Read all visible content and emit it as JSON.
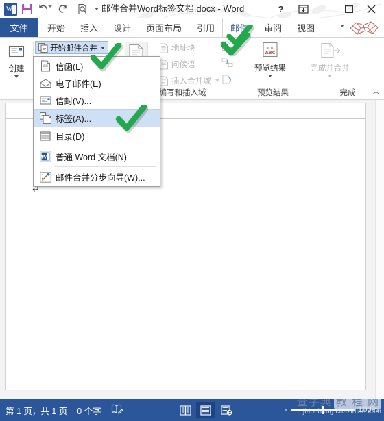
{
  "titlebar": {
    "document_title": "邮件合并Word标签文档.docx - Word",
    "quick_access": [
      {
        "name": "word-logo",
        "label": "W"
      },
      {
        "name": "save-icon",
        "label": "保存"
      },
      {
        "name": "undo-icon",
        "label": "撤消"
      },
      {
        "name": "redo-icon",
        "label": "恢复"
      },
      {
        "name": "print-preview-icon",
        "label": "打印预览和打印"
      }
    ],
    "help_label": "?",
    "ribbon_display_label": "⛶",
    "minimize_label": "—",
    "maximize_label": "❐",
    "close_label": "✕"
  },
  "tabs": {
    "file_label": "文件",
    "items": [
      {
        "label": "开始",
        "active": false
      },
      {
        "label": "插入",
        "active": false
      },
      {
        "label": "设计",
        "active": false
      },
      {
        "label": "页面布局",
        "active": false
      },
      {
        "label": "引用",
        "active": false
      },
      {
        "label": "邮件",
        "active": true
      },
      {
        "label": "审阅",
        "active": false
      },
      {
        "label": "视图",
        "active": false
      }
    ]
  },
  "ribbon": {
    "groups": [
      {
        "name": "create",
        "label": "创建"
      },
      {
        "name": "start-mail-merge",
        "label": "开始邮件合并"
      },
      {
        "name": "write-insert-fields",
        "label": "编写和插入域"
      },
      {
        "name": "preview-results",
        "label": "预览结果"
      },
      {
        "name": "finish",
        "label": "完成"
      }
    ],
    "create_button": "创建",
    "start_mailmerge_button": "开始邮件合并",
    "address_block": "地址块",
    "greeting_line": "问候语",
    "insert_merge_field": "插入合并域",
    "write_insert_group_label": "编写和插入域",
    "preview_results_button": "预览结果",
    "preview_group_label": "预览结果",
    "finish_merge_button": "完成并合并",
    "finish_group_label": "完成",
    "collapse_ribbon": "︿"
  },
  "menu": {
    "items": [
      {
        "label": "信函(L)",
        "icon": "letter-icon",
        "selected": false,
        "sep_after": false
      },
      {
        "label": "电子邮件(E)",
        "icon": "envelope-open-icon",
        "selected": false,
        "sep_after": false
      },
      {
        "label": "信封(V)...",
        "icon": "envelope-icon",
        "selected": false,
        "sep_after": false
      },
      {
        "label": "标签(A)...",
        "icon": "labels-icon",
        "selected": true,
        "sep_after": false
      },
      {
        "label": "目录(D)",
        "icon": "directory-icon",
        "selected": false,
        "sep_after": true
      },
      {
        "label": "普通 Word 文档(N)",
        "icon": "word-doc-icon",
        "selected": false,
        "sep_after": true
      },
      {
        "label": "邮件合并分步向导(W)...",
        "icon": "wizard-icon",
        "selected": false,
        "sep_after": false
      }
    ]
  },
  "document": {
    "paragraph_mark": "↵"
  },
  "statusbar": {
    "page_info": "第 1 页，共 1 页",
    "word_count": "0 个字",
    "proofing_icon": "proofing-icon",
    "views": [
      {
        "name": "read-mode-view",
        "active": false
      },
      {
        "name": "print-layout-view",
        "active": true
      },
      {
        "name": "web-layout-view",
        "active": false
      }
    ],
    "zoom_out_label": "-",
    "zoom_level": "100%",
    "watermark_line1": "查字典",
    "watermark_badge": "教 程 网",
    "watermark_line2": "jiaocheng.chazidian.com"
  },
  "colors": {
    "word_blue": "#2b579a",
    "highlight": "#cfe0f4",
    "check_green": "#22a94e",
    "dim_text": "#b8b8b8"
  }
}
